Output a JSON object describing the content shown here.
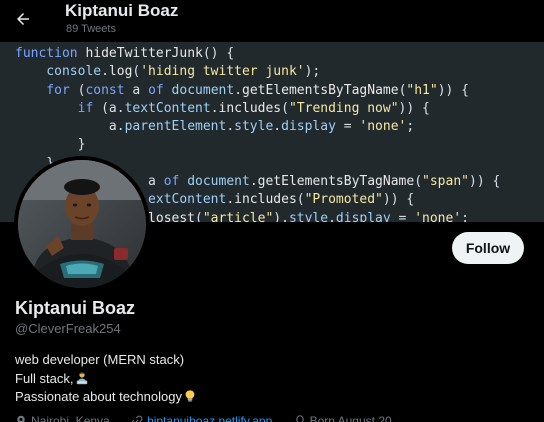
{
  "header": {
    "name": "Kiptanui Boaz",
    "tweet_count": "89 Tweets",
    "back_icon": "arrow-left-icon"
  },
  "banner": {
    "background": "#22292d",
    "code_lines": [
      [
        {
          "t": "function ",
          "c": "kw"
        },
        {
          "t": "hideTwitterJunk",
          "c": "fn"
        },
        {
          "t": "() {",
          "c": "plain"
        }
      ],
      [
        {
          "t": "    console",
          "c": "prop"
        },
        {
          "t": ".",
          "c": "plain"
        },
        {
          "t": "log",
          "c": "fn"
        },
        {
          "t": "(",
          "c": "plain"
        },
        {
          "t": "'hiding twitter junk'",
          "c": "str"
        },
        {
          "t": ");",
          "c": "plain"
        }
      ],
      [
        {
          "t": "    for",
          "c": "kw"
        },
        {
          "t": " (",
          "c": "plain"
        },
        {
          "t": "const",
          "c": "kw"
        },
        {
          "t": " a ",
          "c": "plain"
        },
        {
          "t": "of",
          "c": "kw"
        },
        {
          "t": " document",
          "c": "prop"
        },
        {
          "t": ".",
          "c": "plain"
        },
        {
          "t": "getElementsByTagName",
          "c": "fn"
        },
        {
          "t": "(",
          "c": "plain"
        },
        {
          "t": "\"h1\"",
          "c": "str"
        },
        {
          "t": ")) {",
          "c": "plain"
        }
      ],
      [
        {
          "t": "        if",
          "c": "kw"
        },
        {
          "t": " (a.",
          "c": "plain"
        },
        {
          "t": "textContent",
          "c": "prop"
        },
        {
          "t": ".",
          "c": "plain"
        },
        {
          "t": "includes",
          "c": "fn"
        },
        {
          "t": "(",
          "c": "plain"
        },
        {
          "t": "\"Trending now\"",
          "c": "str"
        },
        {
          "t": ")) {",
          "c": "plain"
        }
      ],
      [
        {
          "t": "            a.",
          "c": "plain"
        },
        {
          "t": "parentElement",
          "c": "prop"
        },
        {
          "t": ".",
          "c": "plain"
        },
        {
          "t": "style",
          "c": "prop"
        },
        {
          "t": ".",
          "c": "plain"
        },
        {
          "t": "display",
          "c": "prop"
        },
        {
          "t": " = ",
          "c": "plain"
        },
        {
          "t": "'none'",
          "c": "str"
        },
        {
          "t": ";",
          "c": "plain"
        }
      ],
      [
        {
          "t": "        }",
          "c": "plain"
        }
      ],
      [
        {
          "t": "    }",
          "c": "plain"
        }
      ],
      [
        {
          "t": "                 a ",
          "c": "plain"
        },
        {
          "t": "of",
          "c": "kw"
        },
        {
          "t": " document",
          "c": "prop"
        },
        {
          "t": ".",
          "c": "plain"
        },
        {
          "t": "getElementsByTagName",
          "c": "fn"
        },
        {
          "t": "(",
          "c": "plain"
        },
        {
          "t": "\"span\"",
          "c": "str"
        },
        {
          "t": ")) {",
          "c": "plain"
        }
      ],
      [
        {
          "t": "                 extContent",
          "c": "prop"
        },
        {
          "t": ".",
          "c": "plain"
        },
        {
          "t": "includes",
          "c": "fn"
        },
        {
          "t": "(",
          "c": "plain"
        },
        {
          "t": "\"Promoted\"",
          "c": "str"
        },
        {
          "t": ")) {",
          "c": "plain"
        }
      ],
      [
        {
          "t": "                 losest",
          "c": "fn"
        },
        {
          "t": "(",
          "c": "plain"
        },
        {
          "t": "\"article\"",
          "c": "str"
        },
        {
          "t": ").",
          "c": "plain"
        },
        {
          "t": "style",
          "c": "prop"
        },
        {
          "t": ".",
          "c": "plain"
        },
        {
          "t": "display",
          "c": "prop"
        },
        {
          "t": " = ",
          "c": "plain"
        },
        {
          "t": "'none'",
          "c": "str"
        },
        {
          "t": ";",
          "c": "plain"
        }
      ]
    ]
  },
  "profile": {
    "avatar_icon": "profile-avatar",
    "follow_label": "Follow",
    "display_name": "Kiptanui Boaz",
    "handle": "@CleverFreak254",
    "bio_lines": [
      "web developer (MERN stack)",
      "Full stack,",
      "Passionate about technology"
    ],
    "bio_emojis": {
      "line2": "technologist-icon",
      "line3": "lightbulb-icon"
    }
  },
  "meta": {
    "location": "Nairobi, Kenya",
    "website": "hiptanuiboaz.netlify.app",
    "born": "Born August 20"
  },
  "colors": {
    "background": "#000000",
    "text_primary": "#e7e9ea",
    "text_secondary": "#71767b",
    "follow_bg": "#eff3f4",
    "follow_text": "#0f1419",
    "link": "#1d9bf0"
  }
}
